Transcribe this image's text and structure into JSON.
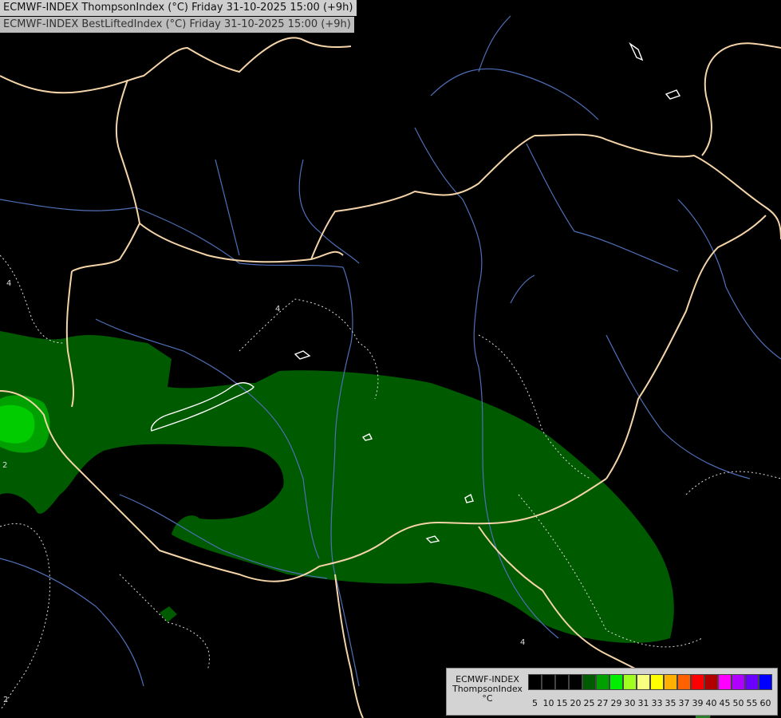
{
  "titles": {
    "line1": "ECMWF-INDEX ThompsonIndex (°C) Friday 31-10-2025 15:00 (+9h)",
    "line2": "ECMWF-INDEX BestLiftedIndex (°C) Friday 31-10-2025 15:00 (+9h)"
  },
  "legend": {
    "model": "ECMWF-INDEX",
    "parameter": "ThompsonIndex",
    "unit": "°C",
    "bins": [
      {
        "label": "5",
        "color": "#000000"
      },
      {
        "label": "10",
        "color": "#000000"
      },
      {
        "label": "15",
        "color": "#000000"
      },
      {
        "label": "20",
        "color": "#000000"
      },
      {
        "label": "25",
        "color": "#005a00"
      },
      {
        "label": "27",
        "color": "#00a000"
      },
      {
        "label": "29",
        "color": "#00ee00"
      },
      {
        "label": "30",
        "color": "#a0ff20"
      },
      {
        "label": "31",
        "color": "#f8ff80"
      },
      {
        "label": "33",
        "color": "#ffff00"
      },
      {
        "label": "35",
        "color": "#ffb000"
      },
      {
        "label": "37",
        "color": "#ff6000"
      },
      {
        "label": "39",
        "color": "#ff0000"
      },
      {
        "label": "40",
        "color": "#b00000"
      },
      {
        "label": "45",
        "color": "#ff00ff"
      },
      {
        "label": "50",
        "color": "#b000ff"
      },
      {
        "label": "55",
        "color": "#6a00ff"
      },
      {
        "label": "60",
        "color": "#0000ff"
      }
    ]
  },
  "map": {
    "colors": {
      "background": "#000000",
      "border": "#f4d4a8",
      "river": "#4f6fb8",
      "contour": "#ffffff",
      "field_25": "#005a00",
      "field_27": "#00a000",
      "field_29": "#00ee00"
    },
    "contour_labels": [
      "4",
      "4",
      "2",
      "2",
      "4",
      "2"
    ]
  }
}
